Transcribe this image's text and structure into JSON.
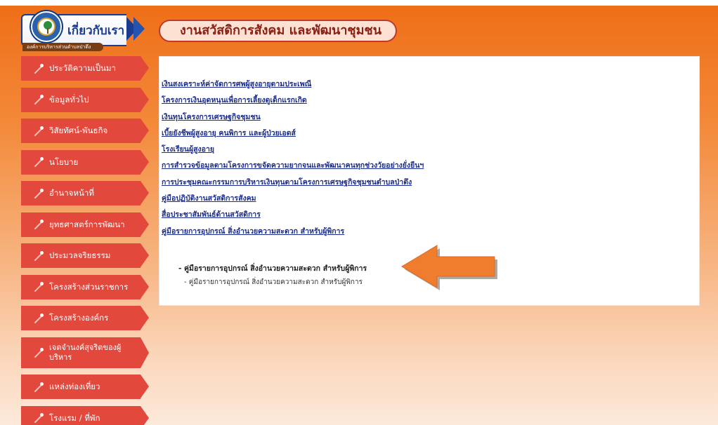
{
  "logo": {
    "title": "เกี่ยวกับเรา",
    "subtitle": "องค์การบริหารส่วนตำบลป่าตึง",
    "icon": "emblem-icon"
  },
  "header": {
    "title": "งานสวัสดิการสังคม และพัฒนาชุมชน"
  },
  "sidebar": {
    "items": [
      {
        "label": "ประวัติความเป็นมา"
      },
      {
        "label": "ข้อมูลทั่วไป"
      },
      {
        "label": "วิสัยทัศน์-พันธกิจ"
      },
      {
        "label": "นโยบาย"
      },
      {
        "label": "อำนาจหน้าที่"
      },
      {
        "label": "ยุทธศาสตร์การพัฒนา"
      },
      {
        "label": "ประมวลจริยธรรม"
      },
      {
        "label": "โครงสร้างส่วนราชการ"
      },
      {
        "label": "โครงสร้างองค์กร"
      },
      {
        "label": "เจตจำนงค์สุจริตของผู้บริหาร"
      },
      {
        "label": "แหล่งท่องเที่ยว"
      },
      {
        "label": "โรงแรม / ที่พัก"
      }
    ]
  },
  "content": {
    "links": [
      {
        "label": "เงินสงเคราะห์ค่าจัดการศพผู้สูงอายุตามประเพณี"
      },
      {
        "label": "โครงการเงินอุดหนุนเพื่อการเลี้ยงดูเด็กแรกเกิด"
      },
      {
        "label": "เงินทุนโครงการเศรษฐกิจชุมชน"
      },
      {
        "label": "เบี้ยยังชีพผู้สูงอายุ คนพิการ และผู้ป่วยเอดส์"
      },
      {
        "label": "โรงเรียนผู้สูงอายุ"
      },
      {
        "label": "การสำรวจข้อมูลตามโครงการขจัดความยากจนและพัฒนาคนทุกช่วงวัยอย่างยั่งยืนฯ"
      },
      {
        "label": "การประชุมคณะกรรมการบริหารเงินทุนตามโครงการเศรษฐกิจชุมชนตำบลป่าตึง"
      },
      {
        "label": "คู่มือปฏิบัติงานสวัสดิการสังคม"
      },
      {
        "label": "สื่อประชาสัมพันธ์ด้านสวัสดิการ"
      },
      {
        "label": "คู่มือรายการอุปกรณ์ สิ่งอำนวยความสะดวก สำหรับผู้พิการ"
      }
    ],
    "sub_item": "- คู่มือรายการอุปกรณ์ สิ่งอำนวยความสะดวก สำหรับผู้พิการ",
    "sub_sub_item": "- คู่มือรายการอุปกรณ์ สิ่งอำนวยความสะดวก สำหรับผู้พิการ"
  },
  "colors": {
    "accent": "#e3483d",
    "link": "#1d2f8e",
    "arrow": "#f07c2e",
    "header_border": "#c0392b"
  }
}
